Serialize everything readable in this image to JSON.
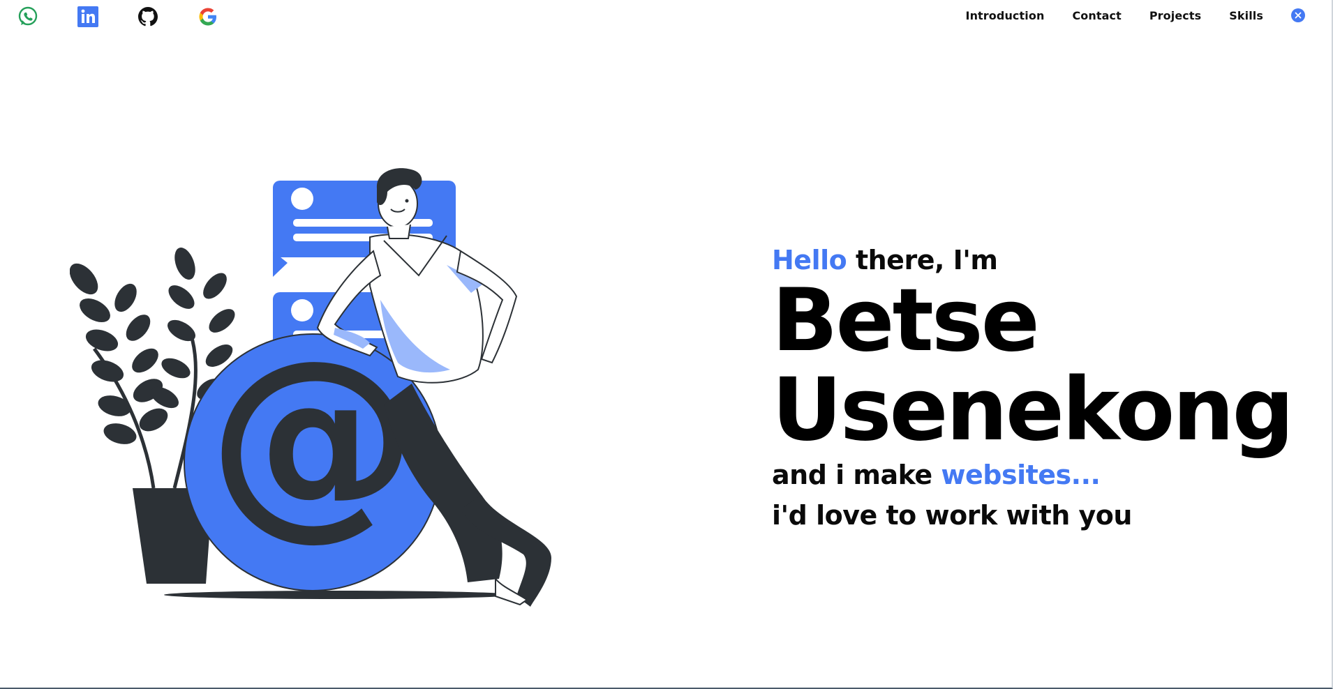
{
  "social": [
    {
      "name": "whatsapp-icon",
      "color": "#25a05a"
    },
    {
      "name": "linkedin-icon",
      "color": "#4479f3"
    },
    {
      "name": "github-icon",
      "color": "#111111"
    },
    {
      "name": "google-icon",
      "color": "#4285f4"
    }
  ],
  "nav": {
    "items": [
      "Introduction",
      "Contact",
      "Projects",
      "Skills"
    ],
    "close_icon": "close-icon"
  },
  "hero": {
    "greeting_highlight": "Hello",
    "greeting_rest": "there, I'm",
    "first_name": "Betse",
    "last_name": "Usenekong",
    "tagline_start": "and i make",
    "tagline_highlight": "websites...",
    "cta": "i'd love to work with you"
  },
  "colors": {
    "accent": "#4479f3",
    "dark": "#2c3136",
    "light_blue": "#9ab8fb"
  }
}
